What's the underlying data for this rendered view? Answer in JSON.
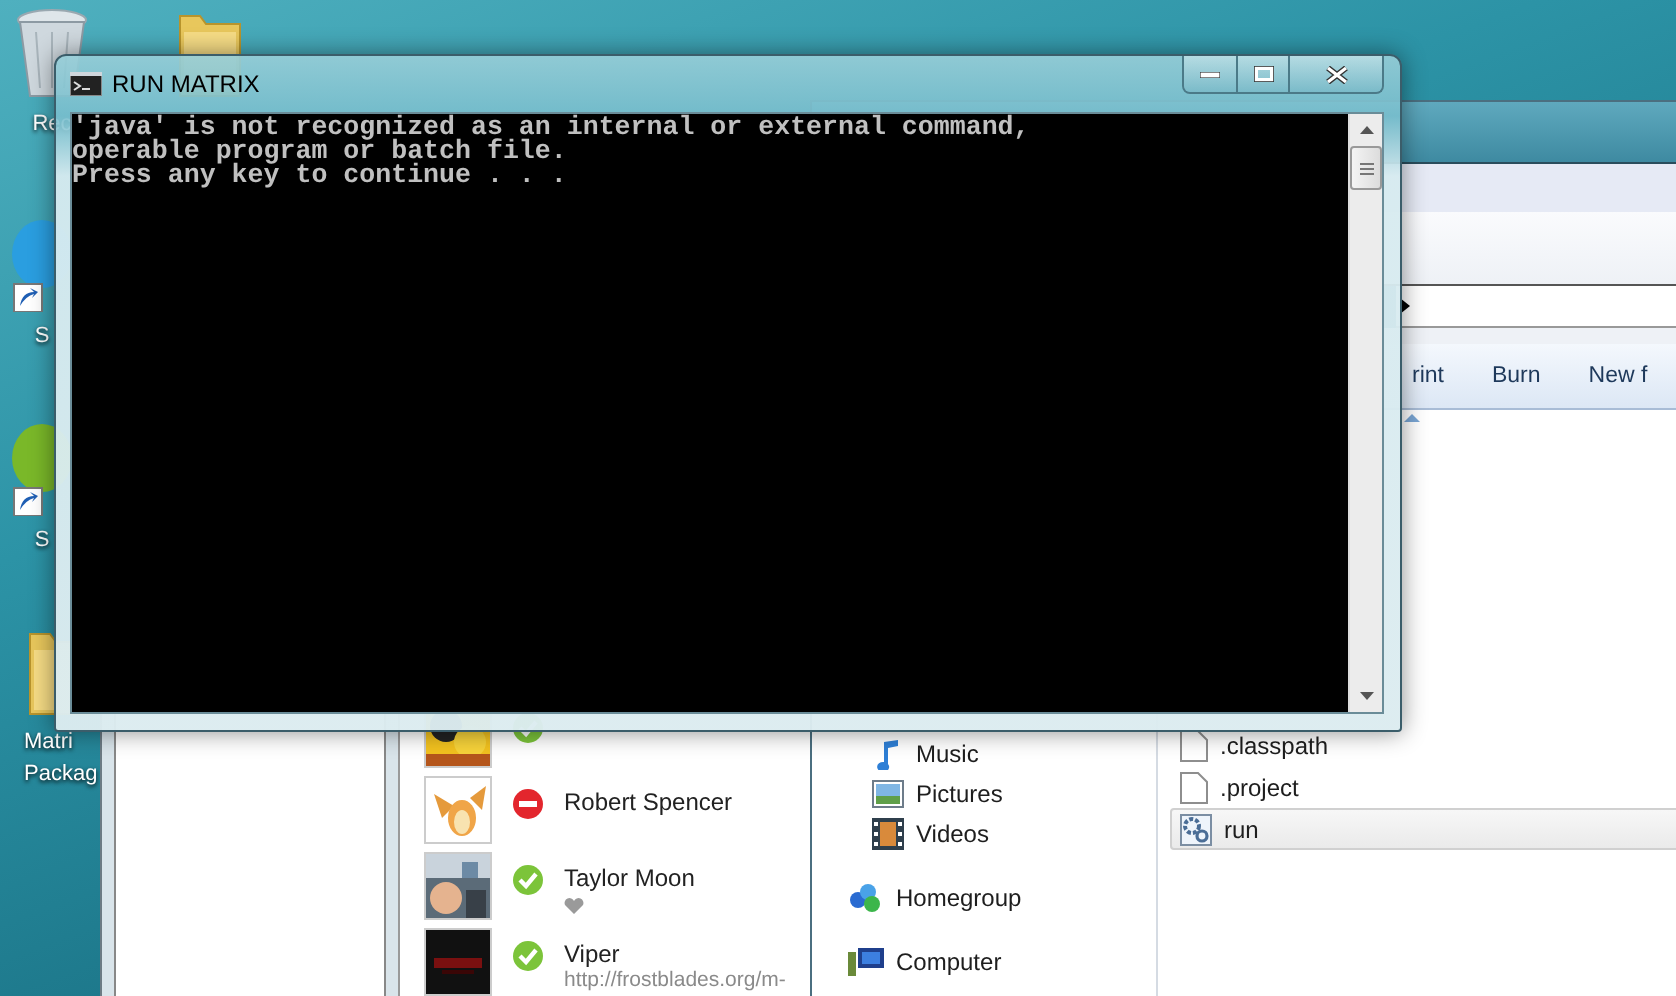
{
  "desktop_icons": [
    {
      "kind": "recycle",
      "label": "Rec"
    },
    {
      "kind": "folder"
    },
    {
      "kind": "shortcut-blue",
      "label": "S"
    },
    {
      "kind": "shortcut-green",
      "label": "S"
    },
    {
      "kind": "folder",
      "label": "Matri\nPackag"
    }
  ],
  "skype": {
    "contacts": [
      {
        "kind": "online"
      },
      {
        "kind": "busy",
        "name": "Robert Spencer"
      },
      {
        "kind": "online",
        "name": "Taylor Moon",
        "mood": {
          "kind": "heart"
        }
      },
      {
        "kind": "online",
        "name": "Viper",
        "mood": {
          "kind": "text",
          "text": "http://frostblades.org/m-"
        }
      }
    ]
  },
  "explorer": {
    "toolbar": [
      "rint",
      "Burn",
      "New f"
    ],
    "nav": [
      {
        "kind": "music",
        "label": "Music"
      },
      {
        "kind": "pictures",
        "label": "Pictures"
      },
      {
        "kind": "videos",
        "label": "Videos"
      },
      {
        "kind": "homegroup",
        "label": "Homegroup"
      },
      {
        "kind": "computer",
        "label": "Computer"
      }
    ],
    "files": [
      {
        "kind": "file",
        "name": ".classpath",
        "selected": false
      },
      {
        "kind": "file",
        "name": ".project",
        "selected": false
      },
      {
        "kind": "batch",
        "name": "run",
        "selected": true
      }
    ]
  },
  "console": {
    "title": "RUN MATRIX",
    "lines": [
      "'java' is not recognized as an internal or external command,",
      "operable program or batch file.",
      "Press any key to continue . . ."
    ]
  }
}
